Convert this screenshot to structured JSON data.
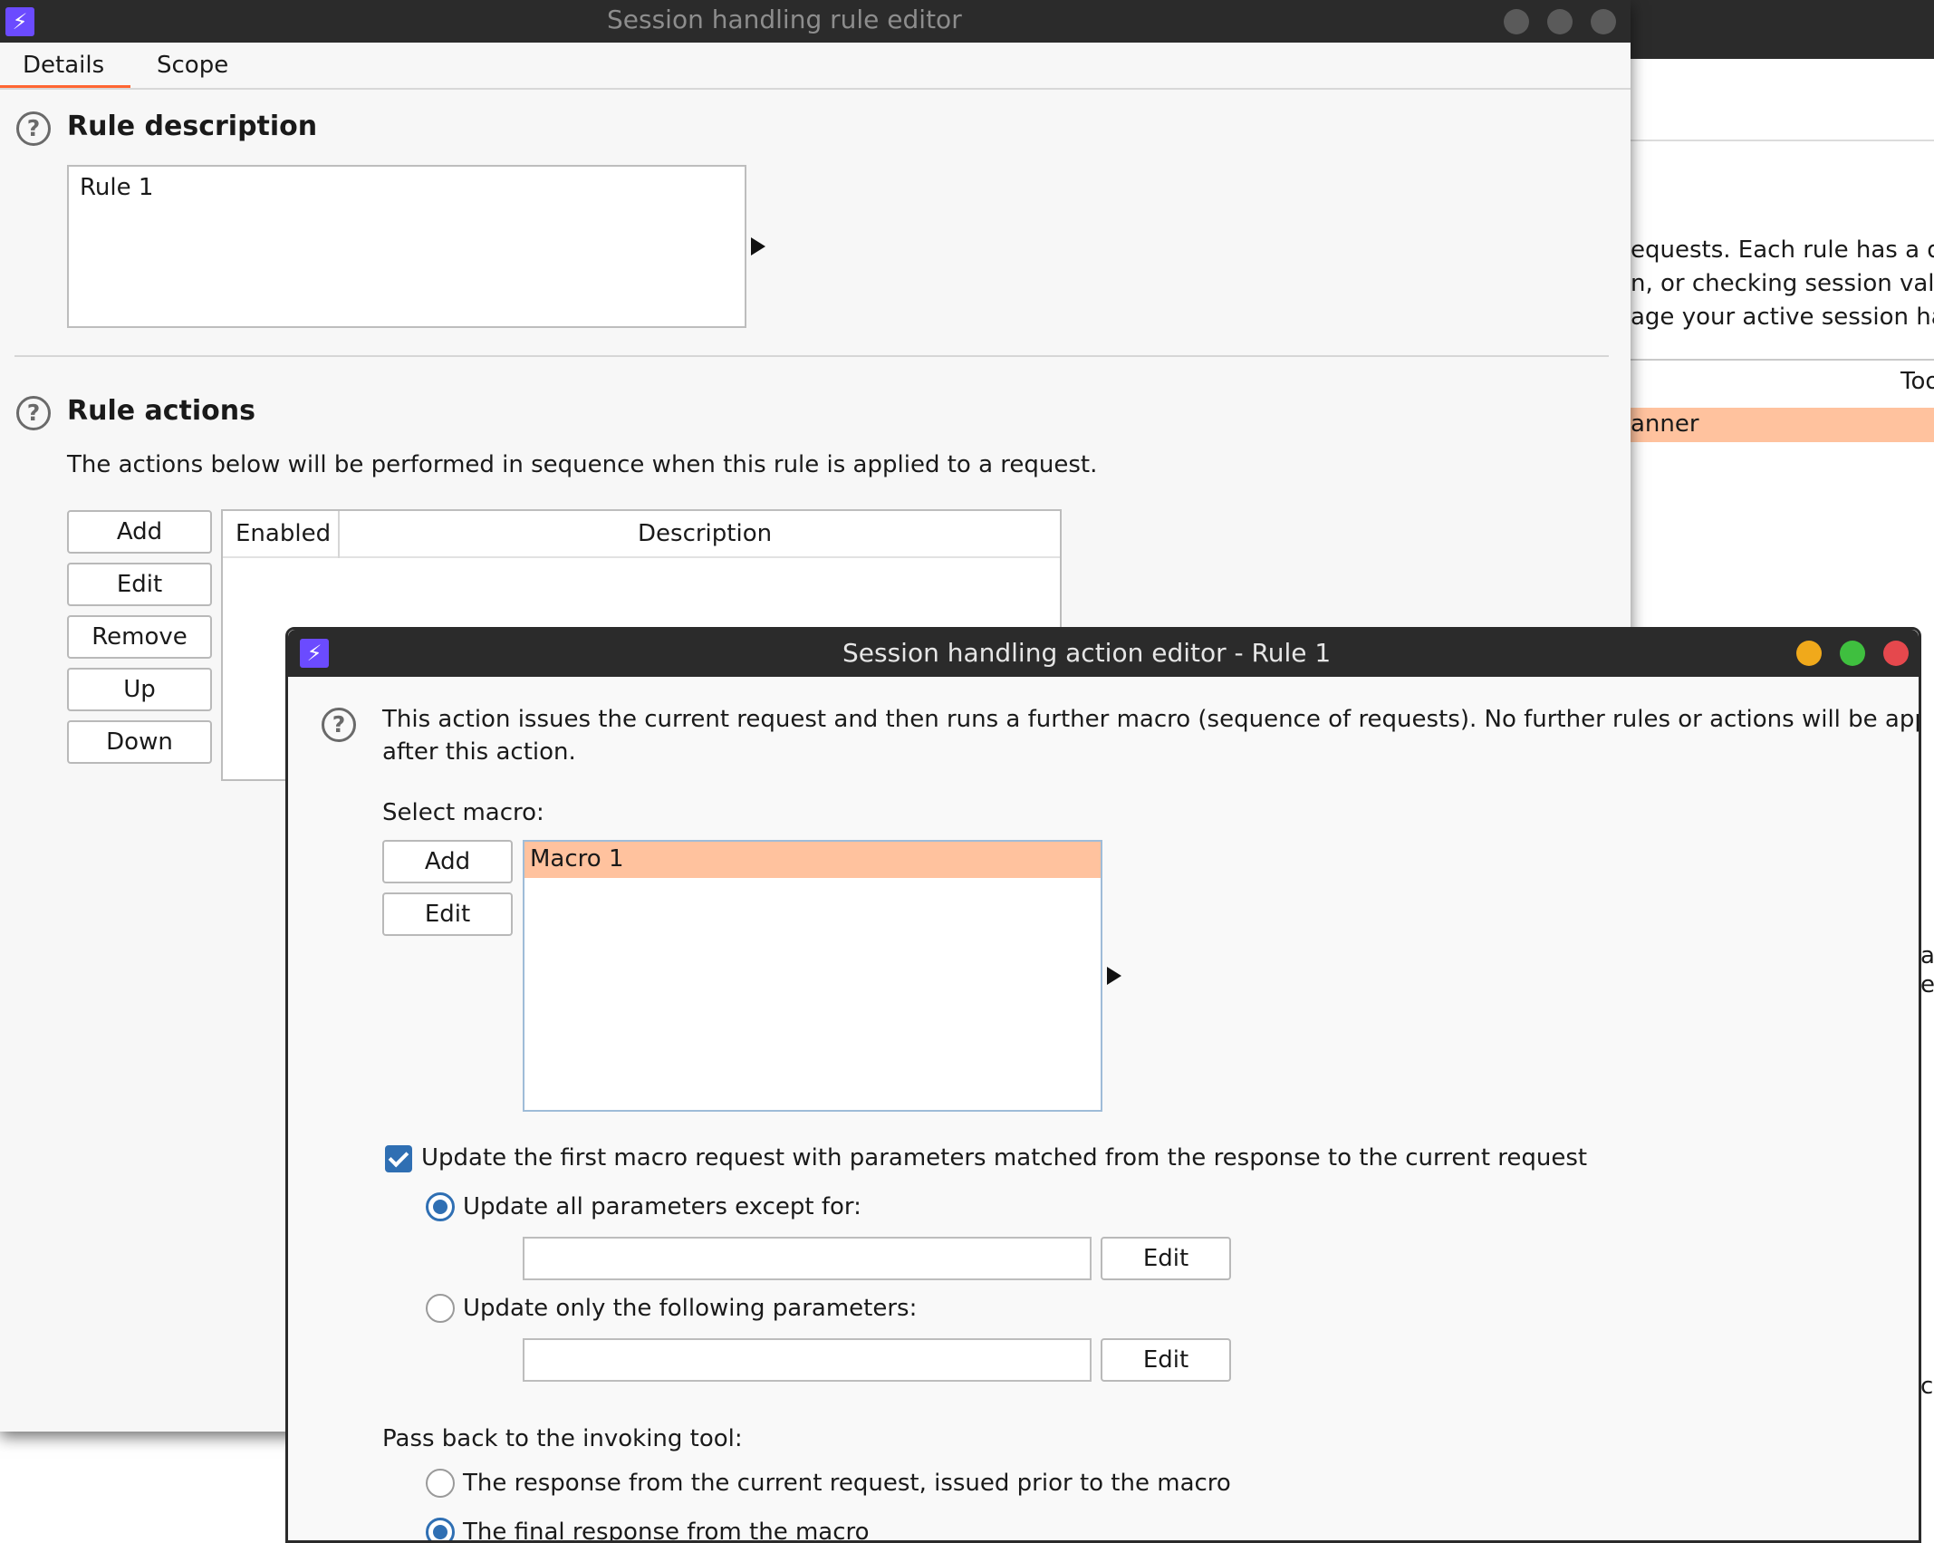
{
  "background_window": {
    "paragraph_lines": [
      "equests. Each rule has a de",
      "n, or checking session validi",
      "age your active session hand"
    ],
    "column_header": "Too",
    "selected_row": "anner",
    "right_fragments": [
      "a",
      "e",
      "c"
    ]
  },
  "rule_editor": {
    "title": "Session handling rule editor",
    "tabs": [
      {
        "label": "Details",
        "active": true
      },
      {
        "label": "Scope",
        "active": false
      }
    ],
    "rule_description": {
      "heading": "Rule description",
      "value": "Rule 1"
    },
    "rule_actions": {
      "heading": "Rule actions",
      "description": "The actions below will be performed in sequence when this rule is applied to a request.",
      "buttons": {
        "add": "Add",
        "edit": "Edit",
        "remove": "Remove",
        "up": "Up",
        "down": "Down"
      },
      "table_headers": {
        "enabled": "Enabled",
        "description": "Description"
      }
    }
  },
  "action_editor": {
    "title": "Session handling action editor - Rule 1",
    "info_line1": "This action issues the current request and then runs a further macro (sequence of requests). No further rules or actions will be applied",
    "info_line2": "after this action.",
    "select_macro_label": "Select macro:",
    "macro_buttons": {
      "add": "Add",
      "edit": "Edit"
    },
    "macros": [
      "Macro 1"
    ],
    "update_checkbox": {
      "label": "Update the first macro request with parameters matched from the response to the current request",
      "checked": true
    },
    "update_all": {
      "label": "Update all parameters except for:",
      "selected": true,
      "value": "",
      "edit_label": "Edit"
    },
    "update_only": {
      "label": "Update only the following parameters:",
      "selected": false,
      "value": "",
      "edit_label": "Edit"
    },
    "pass_back_label": "Pass back to the invoking tool:",
    "pass_back_options": [
      {
        "label": "The response from the current request, issued prior to the macro",
        "selected": false
      },
      {
        "label": "The final response from the macro",
        "selected": true
      }
    ]
  },
  "colors": {
    "titlebar": "#2b2b2b",
    "tab_accent": "#ff6633",
    "selection": "#ffc29e",
    "control_blue": "#2f6fb3",
    "close_red": "#e5484d",
    "min_yellow": "#f0a91b",
    "max_green": "#3fbf3f",
    "app_icon": "#6b4bff"
  }
}
